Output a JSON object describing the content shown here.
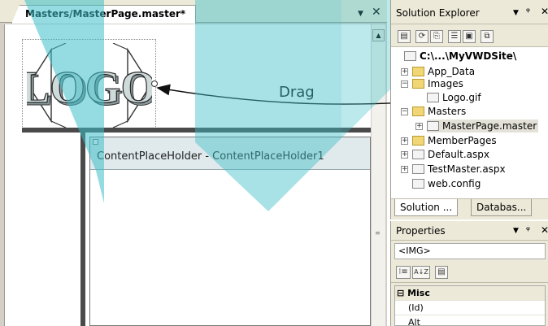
{
  "document": {
    "tab_label": "Masters/MasterPage.master*",
    "dropdown_icon": "▼",
    "close_icon": "✕",
    "scroll_up": "▲",
    "grip": "≡"
  },
  "design": {
    "logo_text": "LOGO",
    "drag_label": "Drag",
    "content_placeholder_label": "ContentPlaceHolder - ContentPlaceHolder1"
  },
  "solution_explorer": {
    "title": "Solution Explorer",
    "title_dropdown": "▼",
    "title_pin": "ᵠ",
    "title_close": "✕",
    "toolbar_buttons": [
      "▤",
      "⟳",
      "⎘",
      "☰",
      "▣",
      "⧉"
    ],
    "tree": [
      {
        "label": "C:\\...\\MyVWDSite\\",
        "icon": "site-icon",
        "expander": ""
      },
      {
        "label": "App_Data",
        "icon": "folder-icon",
        "expander": "+"
      },
      {
        "label": "Images",
        "icon": "folder-open-icon",
        "expander": "−"
      },
      {
        "label": "Logo.gif",
        "icon": "image-file-icon",
        "expander": ""
      },
      {
        "label": "Masters",
        "icon": "folder-open-icon",
        "expander": "−"
      },
      {
        "label": "MasterPage.master",
        "icon": "master-file-icon",
        "expander": "+"
      },
      {
        "label": "MemberPages",
        "icon": "folder-icon",
        "expander": "+"
      },
      {
        "label": "Default.aspx",
        "icon": "aspx-file-icon",
        "expander": "+"
      },
      {
        "label": "TestMaster.aspx",
        "icon": "aspx-file-icon",
        "expander": "+"
      },
      {
        "label": "web.config",
        "icon": "config-file-icon",
        "expander": ""
      }
    ],
    "bottom_tabs": [
      "Solution ...",
      "Databas..."
    ]
  },
  "properties": {
    "title": "Properties",
    "title_dropdown": "▼",
    "title_pin": "ᵠ",
    "title_close": "✕",
    "object": "<IMG>",
    "toolbar_buttons": [
      "⁝≡",
      "A↓Z",
      "▤"
    ],
    "category": "Misc",
    "category_expander": "⊟",
    "rows": [
      "(Id)",
      "Alt"
    ]
  },
  "colors": {
    "watermark": "#3dbfc8",
    "placeholder_header": "#e0e9ec",
    "master_bars": "#4a4a4a"
  }
}
